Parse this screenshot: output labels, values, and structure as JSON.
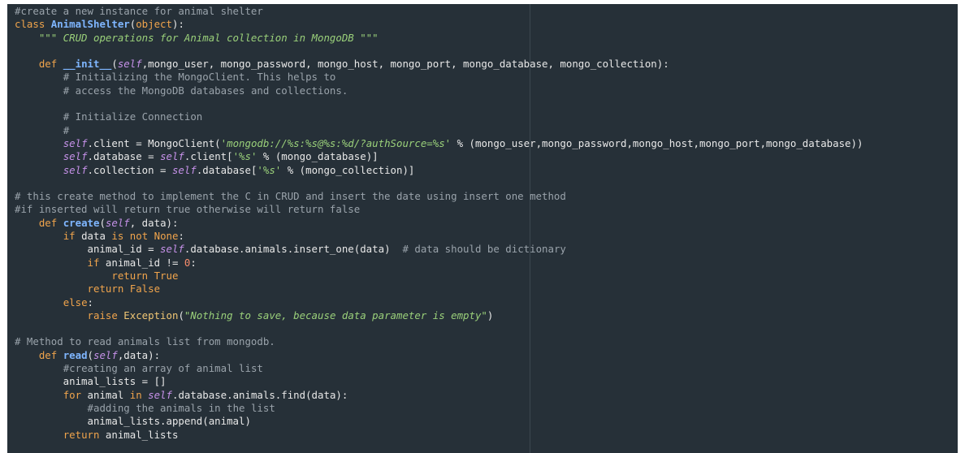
{
  "editor": {
    "lines": [
      [
        {
          "t": "cm",
          "v": "#create a new instance for animal shelter"
        }
      ],
      [
        {
          "t": "kw",
          "v": "class "
        },
        {
          "t": "cls",
          "v": "AnimalShelter"
        },
        {
          "t": "p",
          "v": "("
        },
        {
          "t": "kw",
          "v": "object"
        },
        {
          "t": "p",
          "v": "):"
        }
      ],
      [
        {
          "t": "p",
          "v": "    "
        },
        {
          "t": "str",
          "v": "\"\"\" CRUD operations for Animal collection in MongoDB \"\"\""
        }
      ],
      [],
      [
        {
          "t": "p",
          "v": "    "
        },
        {
          "t": "kw",
          "v": "def "
        },
        {
          "t": "fn",
          "v": "__init__"
        },
        {
          "t": "p",
          "v": "("
        },
        {
          "t": "self",
          "v": "self"
        },
        {
          "t": "p",
          "v": ",mongo_user, mongo_password, mongo_host, mongo_port, mongo_database, mongo_collection):"
        }
      ],
      [
        {
          "t": "p",
          "v": "        "
        },
        {
          "t": "cm",
          "v": "# Initializing the MongoClient. This helps to"
        }
      ],
      [
        {
          "t": "p",
          "v": "        "
        },
        {
          "t": "cm",
          "v": "# access the MongoDB databases and collections."
        }
      ],
      [],
      [
        {
          "t": "p",
          "v": "        "
        },
        {
          "t": "cm",
          "v": "# Initialize Connection"
        }
      ],
      [
        {
          "t": "p",
          "v": "        "
        },
        {
          "t": "cm",
          "v": "#"
        }
      ],
      [
        {
          "t": "p",
          "v": "        "
        },
        {
          "t": "self",
          "v": "self"
        },
        {
          "t": "p",
          "v": ".client = MongoClient("
        },
        {
          "t": "str",
          "v": "'mongodb://%s:%s@%s:%d/?authSource=%s'"
        },
        {
          "t": "p",
          "v": " % (mongo_user,mongo_password,mongo_host,mongo_port,mongo_database))"
        }
      ],
      [
        {
          "t": "p",
          "v": "        "
        },
        {
          "t": "self",
          "v": "self"
        },
        {
          "t": "p",
          "v": ".database = "
        },
        {
          "t": "self",
          "v": "self"
        },
        {
          "t": "p",
          "v": ".client["
        },
        {
          "t": "str",
          "v": "'%s'"
        },
        {
          "t": "p",
          "v": " % (mongo_database)]"
        }
      ],
      [
        {
          "t": "p",
          "v": "        "
        },
        {
          "t": "self",
          "v": "self"
        },
        {
          "t": "p",
          "v": ".collection = "
        },
        {
          "t": "self",
          "v": "self"
        },
        {
          "t": "p",
          "v": ".database["
        },
        {
          "t": "str",
          "v": "'%s'"
        },
        {
          "t": "p",
          "v": " % (mongo_collection)]"
        }
      ],
      [],
      [
        {
          "t": "cm",
          "v": "# this create method to implement the C in CRUD and insert the date using insert one method"
        }
      ],
      [
        {
          "t": "cm",
          "v": "#if inserted will return true otherwise will return false"
        }
      ],
      [
        {
          "t": "p",
          "v": "    "
        },
        {
          "t": "kw",
          "v": "def "
        },
        {
          "t": "fn",
          "v": "create"
        },
        {
          "t": "p",
          "v": "("
        },
        {
          "t": "self",
          "v": "self"
        },
        {
          "t": "p",
          "v": ", data):"
        }
      ],
      [
        {
          "t": "p",
          "v": "        "
        },
        {
          "t": "kw",
          "v": "if "
        },
        {
          "t": "p",
          "v": "data "
        },
        {
          "t": "kw",
          "v": "is not None"
        },
        {
          "t": "p",
          "v": ":"
        }
      ],
      [
        {
          "t": "p",
          "v": "            animal_id = "
        },
        {
          "t": "self",
          "v": "self"
        },
        {
          "t": "p",
          "v": ".database.animals.insert_one(data)  "
        },
        {
          "t": "cm",
          "v": "# data should be dictionary"
        }
      ],
      [
        {
          "t": "p",
          "v": "            "
        },
        {
          "t": "kw",
          "v": "if "
        },
        {
          "t": "p",
          "v": "animal_id != "
        },
        {
          "t": "num",
          "v": "0"
        },
        {
          "t": "p",
          "v": ":"
        }
      ],
      [
        {
          "t": "p",
          "v": "                "
        },
        {
          "t": "kw",
          "v": "return True"
        }
      ],
      [
        {
          "t": "p",
          "v": "            "
        },
        {
          "t": "kw",
          "v": "return False"
        }
      ],
      [
        {
          "t": "p",
          "v": "        "
        },
        {
          "t": "kw",
          "v": "else"
        },
        {
          "t": "p",
          "v": ":"
        }
      ],
      [
        {
          "t": "p",
          "v": "            "
        },
        {
          "t": "kw",
          "v": "raise "
        },
        {
          "t": "exc",
          "v": "Exception"
        },
        {
          "t": "p",
          "v": "("
        },
        {
          "t": "str",
          "v": "\"Nothing to save, because data parameter is empty\""
        },
        {
          "t": "p",
          "v": ")"
        }
      ],
      [],
      [
        {
          "t": "cm",
          "v": "# Method to read animals list from mongodb."
        }
      ],
      [
        {
          "t": "p",
          "v": "    "
        },
        {
          "t": "kw",
          "v": "def "
        },
        {
          "t": "fn",
          "v": "read"
        },
        {
          "t": "p",
          "v": "("
        },
        {
          "t": "self",
          "v": "self"
        },
        {
          "t": "p",
          "v": ",data):"
        }
      ],
      [
        {
          "t": "p",
          "v": "        "
        },
        {
          "t": "cm",
          "v": "#creating an array of animal list"
        }
      ],
      [
        {
          "t": "p",
          "v": "        animal_lists = []"
        }
      ],
      [
        {
          "t": "p",
          "v": "        "
        },
        {
          "t": "kw",
          "v": "for "
        },
        {
          "t": "p",
          "v": "animal "
        },
        {
          "t": "kw",
          "v": "in "
        },
        {
          "t": "self",
          "v": "self"
        },
        {
          "t": "p",
          "v": ".database.animals.find(data):"
        }
      ],
      [
        {
          "t": "p",
          "v": "            "
        },
        {
          "t": "cm",
          "v": "#adding the animals in the list"
        }
      ],
      [
        {
          "t": "p",
          "v": "            animal_lists.append(animal)"
        }
      ],
      [
        {
          "t": "p",
          "v": "        "
        },
        {
          "t": "kw",
          "v": "return "
        },
        {
          "t": "p",
          "v": "animal_lists"
        }
      ]
    ]
  },
  "colors": {
    "background": "#263038",
    "keyword": "#f0a44c",
    "function": "#7fb6ff",
    "self": "#c792ea",
    "string": "#9ad07a",
    "comment": "#9aa3ab",
    "number": "#f78c6c"
  }
}
